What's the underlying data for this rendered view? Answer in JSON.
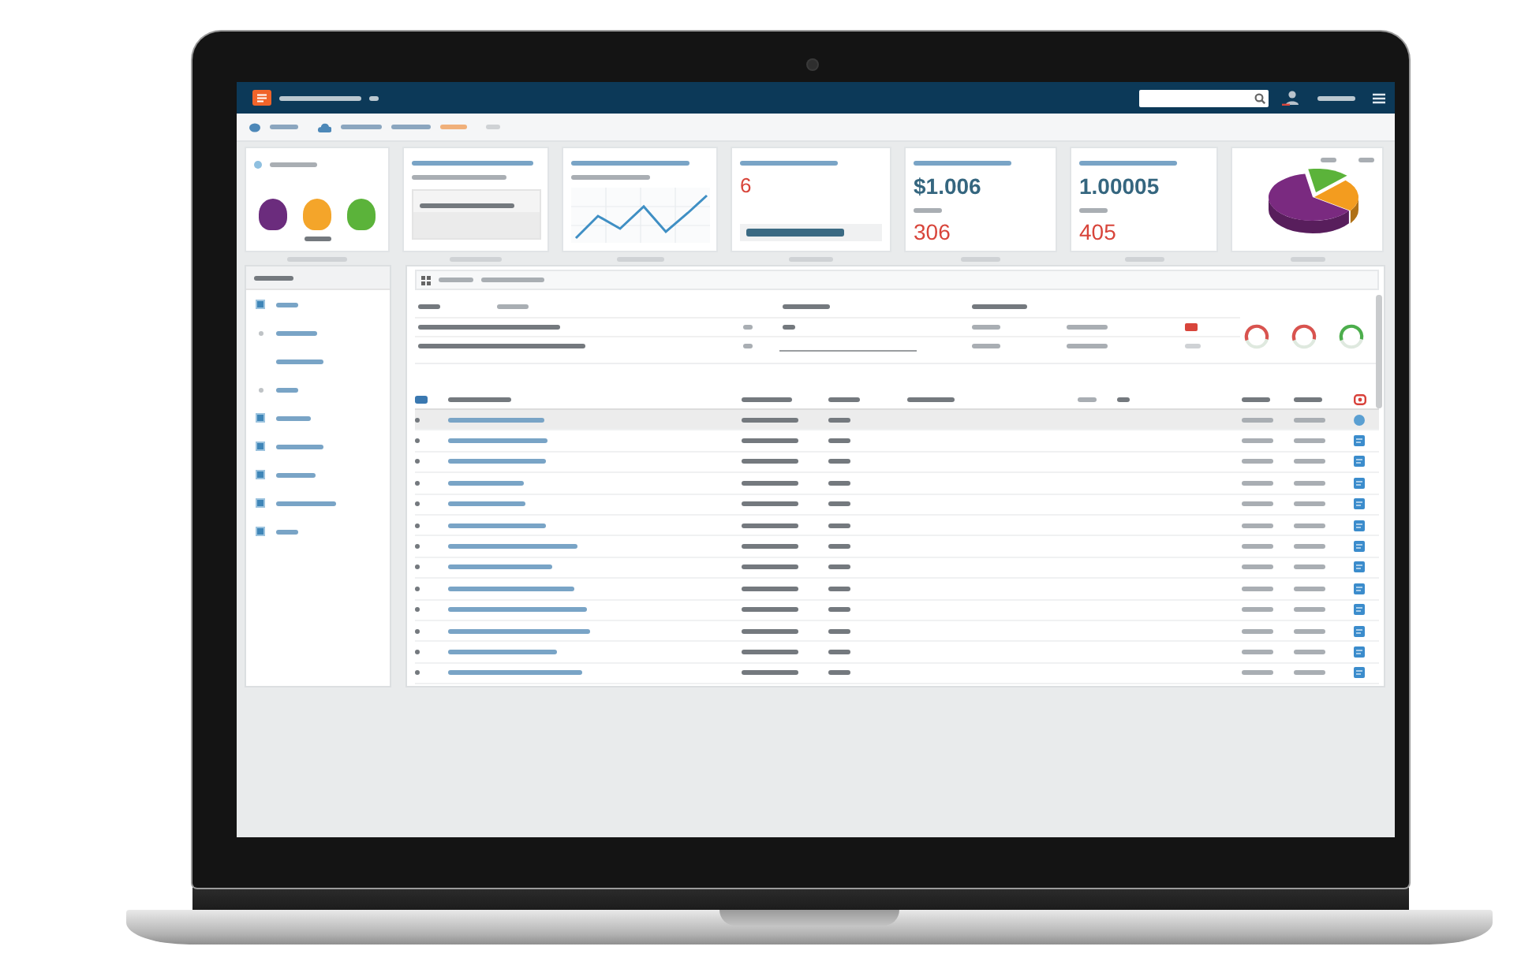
{
  "kpi_cards": [
    {
      "kind": "badges",
      "badges": [
        {
          "color": "#6b2c7d"
        },
        {
          "color": "#f4a52a"
        },
        {
          "color": "#5bb33a"
        }
      ]
    },
    {
      "kind": "panel"
    },
    {
      "kind": "sparkline"
    },
    {
      "kind": "count",
      "value": "6"
    },
    {
      "kind": "amount",
      "value": "$1.006",
      "sub_value": "306"
    },
    {
      "kind": "amount",
      "value": "1.00005",
      "sub_value": "405"
    },
    {
      "kind": "pie",
      "slices": [
        {
          "color": "#5bb33a"
        },
        {
          "color": "#f39c1f"
        },
        {
          "color": "#7a2a80"
        }
      ]
    }
  ],
  "sidebar": {
    "items": [
      {
        "kind": "icon"
      },
      {
        "kind": "dot"
      },
      {
        "kind": "plain"
      },
      {
        "kind": "dot"
      },
      {
        "kind": "icon"
      },
      {
        "kind": "icon"
      },
      {
        "kind": "icon"
      },
      {
        "kind": "icon"
      },
      {
        "kind": "icon"
      }
    ]
  },
  "summary": {
    "rows": [
      {
        "kind": "flag"
      },
      {
        "kind": "field"
      }
    ],
    "rings": [
      {
        "color": "#d9534f"
      },
      {
        "color": "#d9534f"
      },
      {
        "color": "#4cae4c"
      }
    ]
  },
  "table": {
    "rows": [
      {
        "selected": true,
        "kind": "circle"
      },
      {
        "selected": false,
        "kind": "square"
      },
      {
        "selected": false,
        "kind": "square"
      },
      {
        "selected": false,
        "kind": "square"
      },
      {
        "selected": false,
        "kind": "square"
      },
      {
        "selected": false,
        "kind": "square"
      },
      {
        "selected": false,
        "kind": "square"
      },
      {
        "selected": false,
        "kind": "square"
      },
      {
        "selected": false,
        "kind": "square"
      },
      {
        "selected": false,
        "kind": "square"
      },
      {
        "selected": false,
        "kind": "square"
      },
      {
        "selected": false,
        "kind": "square"
      },
      {
        "selected": false,
        "kind": "square"
      }
    ]
  }
}
